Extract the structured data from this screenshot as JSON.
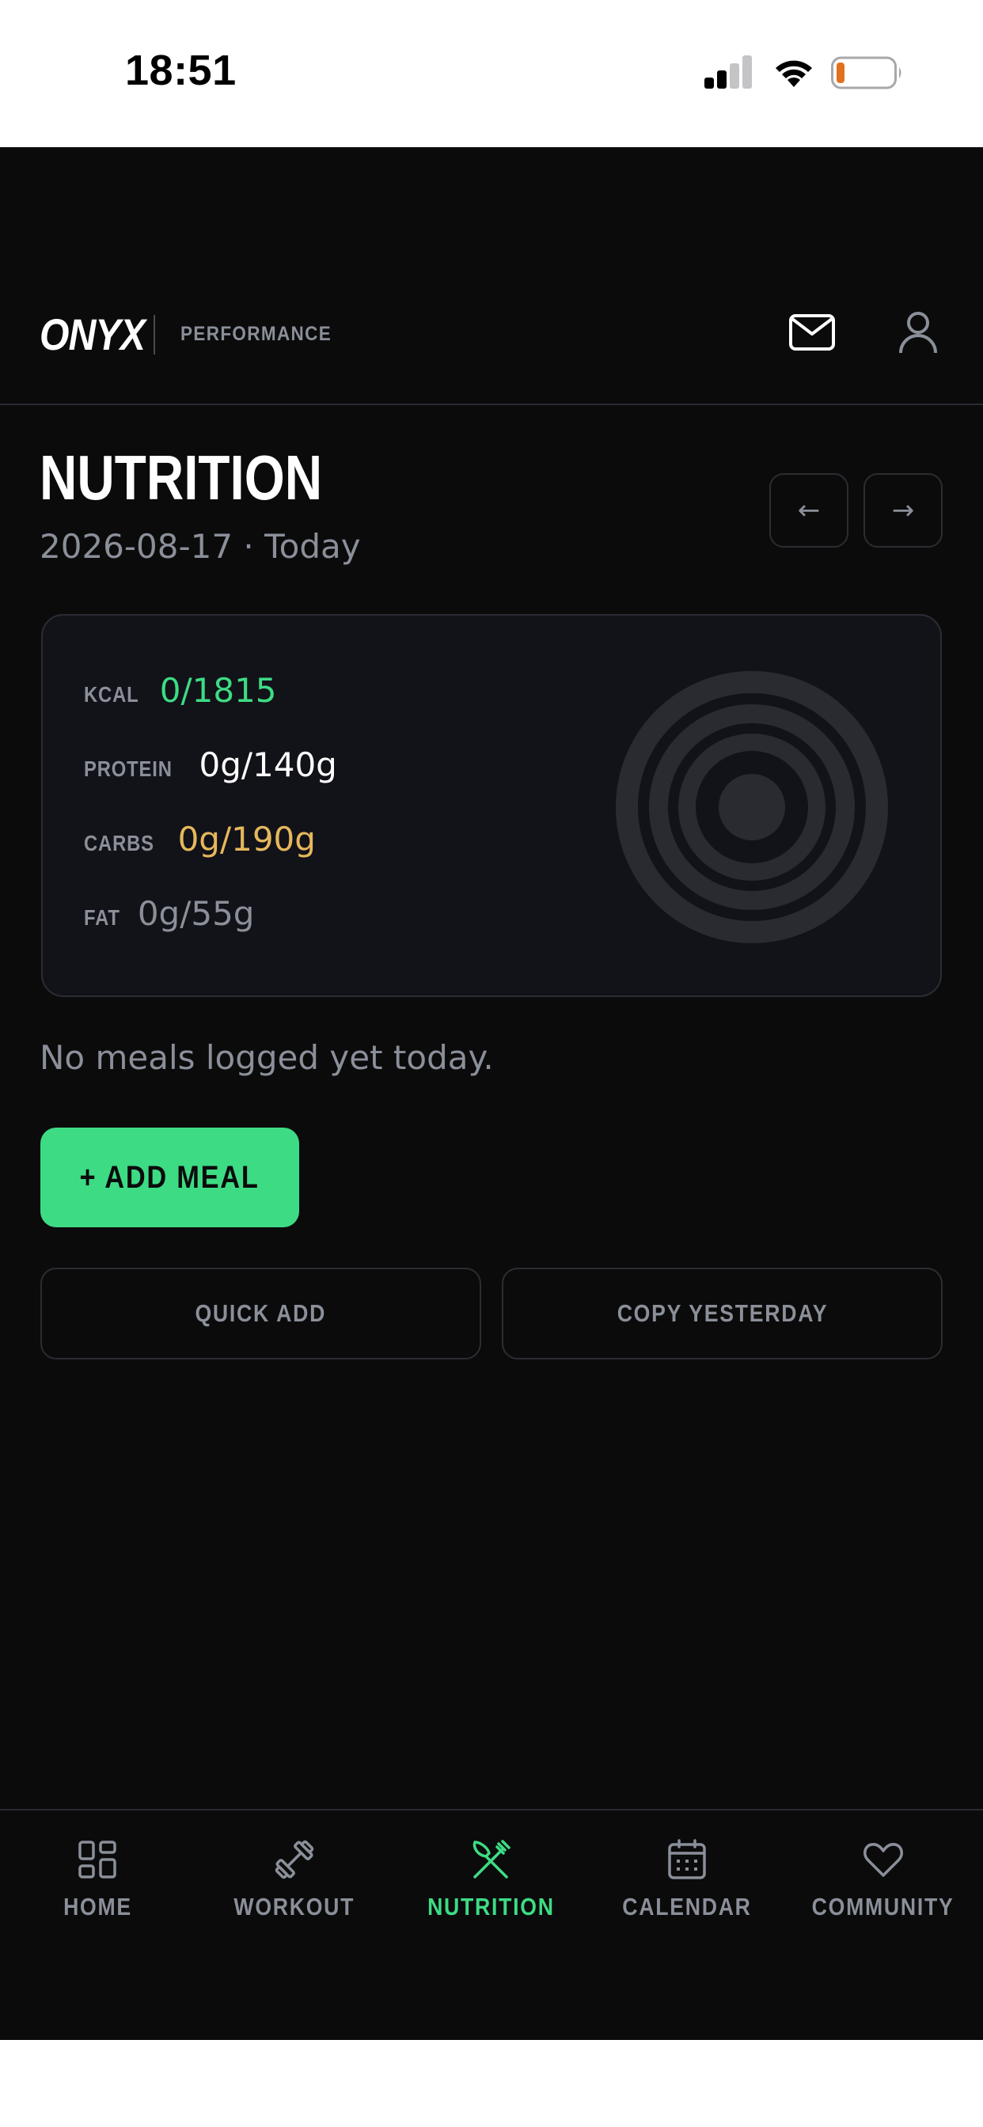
{
  "status_bar": {
    "time": "18:51"
  },
  "header": {
    "logo": "ONYX",
    "logo_subtitle": "PERFORMANCE",
    "icons": {
      "mail": "mail-icon",
      "profile": "user-icon"
    }
  },
  "page": {
    "title": "NUTRITION",
    "date": "2026-08-17 · Today",
    "prev_label": "←",
    "next_label": "→"
  },
  "summary": {
    "kcal": {
      "label": "KCAL",
      "value": "0/1815",
      "color": "#3ddc84"
    },
    "protein": {
      "label": "PROTEIN",
      "value": "0g/140g",
      "color": "#ffffff"
    },
    "carbs": {
      "label": "CARBS",
      "value": "0g/190g",
      "color": "#e6b85c"
    },
    "fat": {
      "label": "FAT",
      "value": "0g/55g",
      "color": "#8a8f99"
    },
    "rings_progress": [
      0,
      0,
      0,
      0
    ]
  },
  "empty_state": "No meals logged yet today.",
  "actions": {
    "add_meal": "+ ADD MEAL",
    "quick_add": "QUICK ADD",
    "copy_yesterday": "COPY YESTERDAY"
  },
  "tabbar": {
    "active": "NUTRITION",
    "accent": "#3ddc84",
    "tabs": [
      {
        "label": "HOME",
        "icon": "grid-icon"
      },
      {
        "label": "WORKOUT",
        "icon": "dumbbell-icon"
      },
      {
        "label": "NUTRITION",
        "icon": "fork-knife-icon"
      },
      {
        "label": "CALENDAR",
        "icon": "calendar-icon"
      },
      {
        "label": "COMMUNITY",
        "icon": "heart-icon"
      }
    ]
  }
}
